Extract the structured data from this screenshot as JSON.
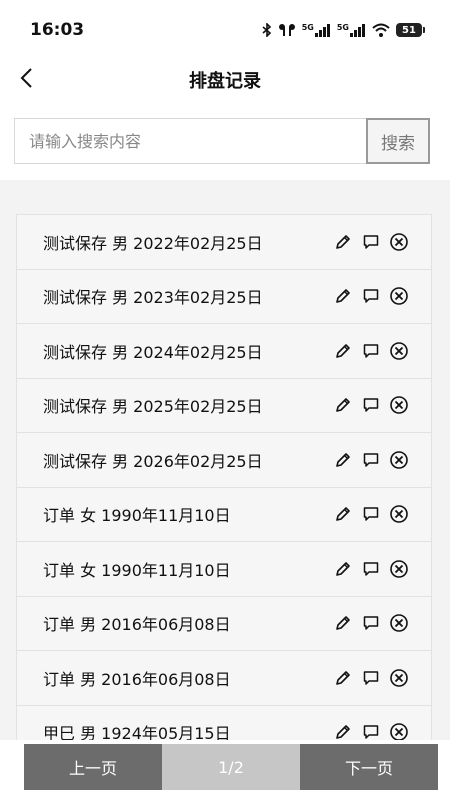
{
  "status_bar": {
    "time": "16:03",
    "network_1": "5G",
    "network_2": "5G",
    "battery": "51"
  },
  "header": {
    "title": "排盘记录",
    "back_icon": "chevron-left-icon"
  },
  "search": {
    "placeholder": "请输入搜索内容",
    "value": "",
    "button_label": "搜索"
  },
  "records": [
    {
      "label": "测试保存 男 2022年02月25日"
    },
    {
      "label": "测试保存 男 2023年02月25日"
    },
    {
      "label": "测试保存 男 2024年02月25日"
    },
    {
      "label": "测试保存 男 2025年02月25日"
    },
    {
      "label": "测试保存 男 2026年02月25日"
    },
    {
      "label": "订单 女 1990年11月10日"
    },
    {
      "label": "订单 女 1990年11月10日"
    },
    {
      "label": "订单 男 2016年06月08日"
    },
    {
      "label": "订单 男 2016年06月08日"
    },
    {
      "label": "甲巳 男 1924年05月15日"
    }
  ],
  "row_action_icons": [
    "pencil-icon",
    "comment-icon",
    "close-circle-icon"
  ],
  "pagination": {
    "prev_label": "上一页",
    "page_indicator": "1/2",
    "next_label": "下一页"
  },
  "colors": {
    "pager_button": "#6c6c6c",
    "pager_indicator": "#c6c6c6",
    "list_background": "#f3f3f3"
  }
}
